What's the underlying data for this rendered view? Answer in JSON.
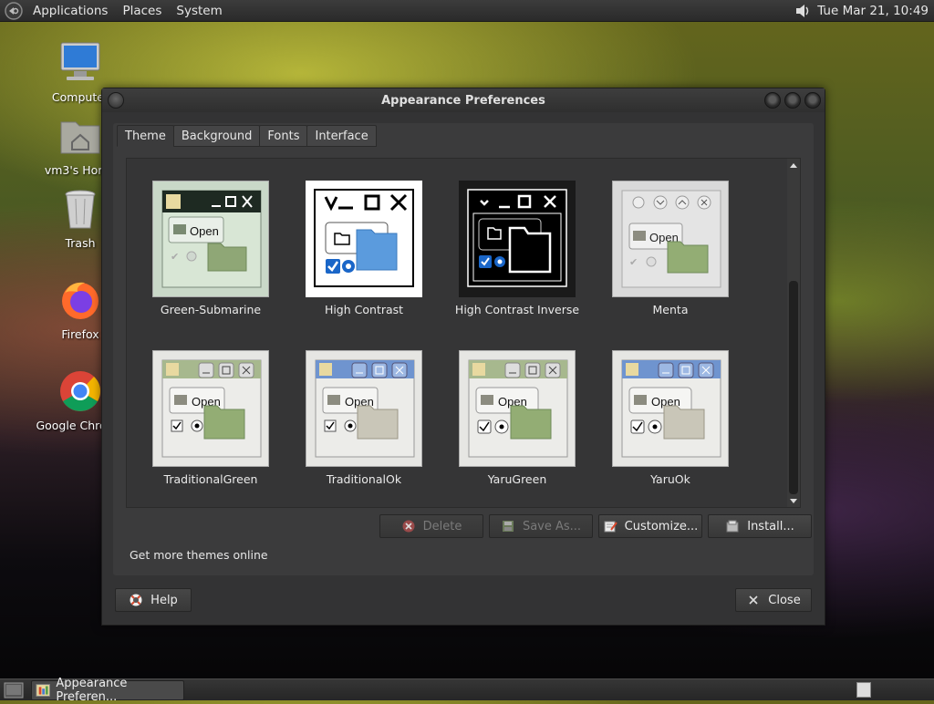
{
  "top_panel": {
    "menus": [
      "Applications",
      "Places",
      "System"
    ],
    "clock": "Tue Mar 21, 10:49"
  },
  "desktop": {
    "icons": [
      {
        "label": "Computer",
        "icon": "computer-icon"
      },
      {
        "label": "vm3's Home",
        "icon": "home-folder-icon"
      },
      {
        "label": "Trash",
        "icon": "trash-icon"
      },
      {
        "label": "Firefox",
        "icon": "firefox-icon"
      },
      {
        "label": "Google Chrome",
        "icon": "chrome-icon"
      }
    ]
  },
  "window": {
    "title": "Appearance Preferences",
    "tabs": [
      "Theme",
      "Background",
      "Fonts",
      "Interface"
    ],
    "active_tab": "Theme",
    "themes": [
      {
        "name": "Green-Submarine",
        "selected": false
      },
      {
        "name": "High Contrast",
        "selected": false
      },
      {
        "name": "High Contrast Inverse",
        "selected": true
      },
      {
        "name": "Menta",
        "selected": false
      },
      {
        "name": "TraditionalGreen",
        "selected": false
      },
      {
        "name": "TraditionalOk",
        "selected": false
      },
      {
        "name": "YaruGreen",
        "selected": false
      },
      {
        "name": "YaruOk",
        "selected": false
      }
    ],
    "thumbnail_text": "Open",
    "buttons": {
      "delete": "Delete",
      "save_as": "Save As...",
      "customize": "Customize...",
      "install": "Install...",
      "help": "Help",
      "close": "Close"
    },
    "more_themes_link": "Get more themes online"
  },
  "taskbar": {
    "task_label": "Appearance Preferen..."
  },
  "colors": {
    "panel": "#2e2e2e",
    "window_bg": "#333334",
    "content_bg": "#3b3b3c",
    "folder_green": "#93ad74",
    "folder_blue": "#5b9bdd"
  }
}
